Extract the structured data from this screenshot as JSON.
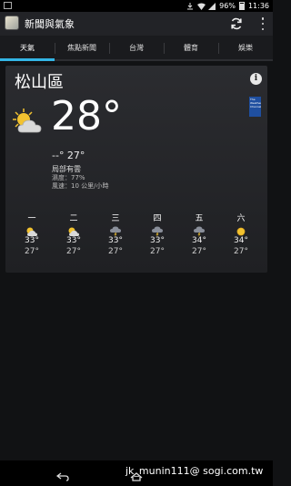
{
  "status": {
    "battery": "96%",
    "time": "11:36"
  },
  "app": {
    "title": "新聞與氣象"
  },
  "tabs": [
    {
      "label": "天氣",
      "active": true
    },
    {
      "label": "焦點新聞",
      "active": false
    },
    {
      "label": "台灣",
      "active": false
    },
    {
      "label": "體育",
      "active": false
    },
    {
      "label": "娛樂",
      "active": false
    }
  ],
  "weather": {
    "location": "松山區",
    "temperature": "28°",
    "hilo": "--° 27°",
    "condition": "局部有雲",
    "humidity": "濕度：77%",
    "wind": "風速：10 公里/小時",
    "logo_text": "The Weather Channel",
    "forecast": [
      {
        "day": "一",
        "hi": "33°",
        "lo": "27°",
        "icon": "partly-cloudy-icon"
      },
      {
        "day": "二",
        "hi": "33°",
        "lo": "27°",
        "icon": "partly-cloudy-icon"
      },
      {
        "day": "三",
        "hi": "33°",
        "lo": "27°",
        "icon": "thunderstorm-icon"
      },
      {
        "day": "四",
        "hi": "33°",
        "lo": "27°",
        "icon": "thunderstorm-icon"
      },
      {
        "day": "五",
        "hi": "34°",
        "lo": "27°",
        "icon": "thunderstorm-icon"
      },
      {
        "day": "六",
        "hi": "34°",
        "lo": "27°",
        "icon": "sunny-icon"
      }
    ]
  },
  "watermark": "jk_munin111@ sogi.com.tw",
  "colors": {
    "accent": "#33b5e5",
    "sun": "#f2c230"
  }
}
